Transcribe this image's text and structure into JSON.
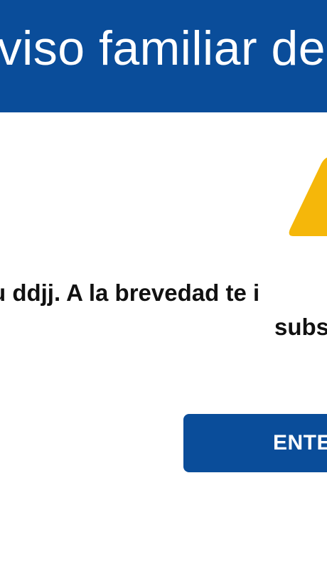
{
  "header": {
    "title": "Aviso familiar de entrada"
  },
  "warning": {
    "icon": "warning-triangle-icon",
    "color": "#f5b70a"
  },
  "message": {
    "line1": "u ddjj. A la brevedad te i",
    "line2": "subs"
  },
  "actions": {
    "confirm_label": "ENTE"
  },
  "colors": {
    "primary": "#0a4d9a",
    "text": "#111111",
    "background": "#ffffff"
  }
}
